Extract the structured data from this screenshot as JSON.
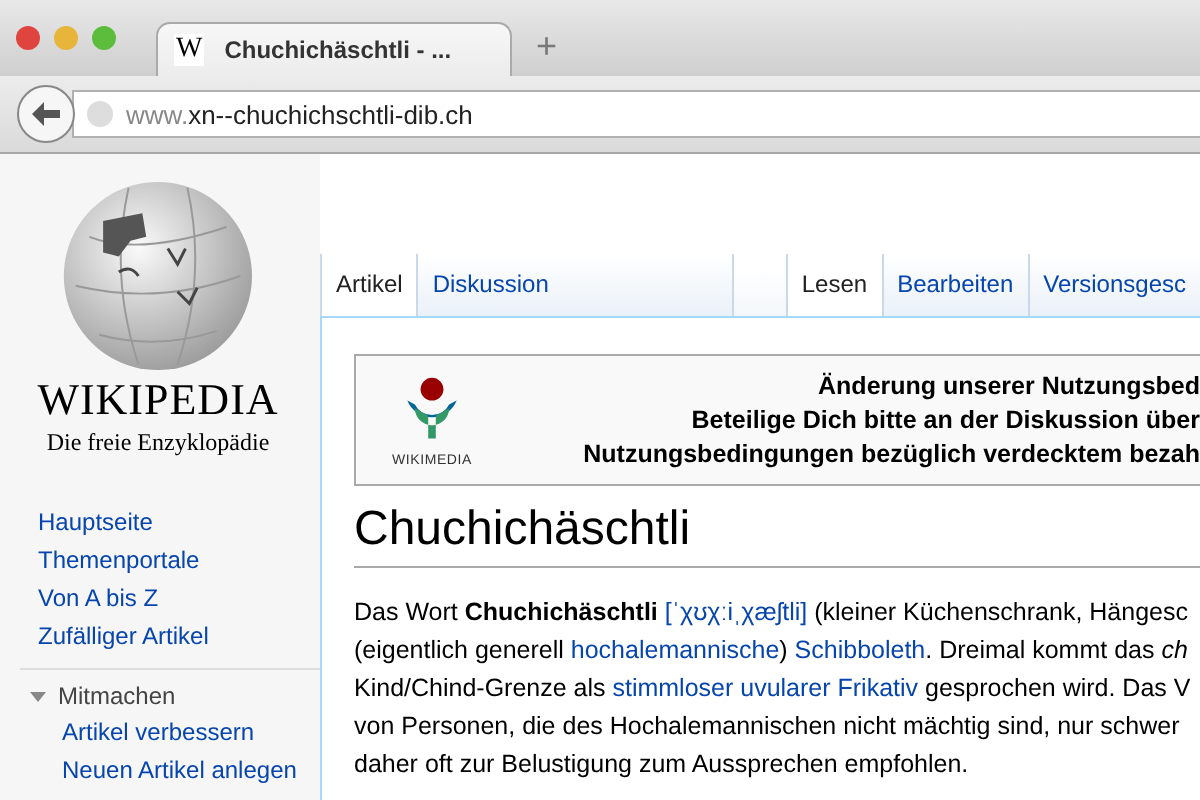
{
  "window": {
    "tab_title": "Chuchichäschtli - ...",
    "tab_icon": "W",
    "new_tab": "+",
    "url_prefix": "www.",
    "url_rest": "xn--chuchichschtli-dib.ch"
  },
  "sidebar": {
    "logo_title": "WIKIPEDIA",
    "logo_subtitle": "Die freie Enzyklopädie",
    "nav": [
      "Hauptseite",
      "Themenportale",
      "Von A bis Z",
      "Zufälliger Artikel"
    ],
    "section": {
      "title": "Mitmachen",
      "expanded": true,
      "items": [
        "Artikel verbessern",
        "Neuen Artikel anlegen"
      ]
    }
  },
  "tabs_left": [
    {
      "label": "Artikel",
      "selected": true
    },
    {
      "label": "Diskussion",
      "selected": false
    }
  ],
  "tabs_right": [
    {
      "label": "Lesen",
      "selected": true
    },
    {
      "label": "Bearbeiten",
      "selected": false
    },
    {
      "label": "Versionsgesc",
      "selected": false
    }
  ],
  "banner": {
    "logo_label": "WIKIMEDIA",
    "lines": [
      "Änderung unserer Nutzungsbed",
      "Beteilige Dich bitte an der Diskussion über",
      "Nutzungsbedingungen bezüglich verdecktem bezah"
    ]
  },
  "article": {
    "title": "Chuchichäschtli",
    "lines": [
      [
        {
          "kind": "text",
          "text": "Das Wort "
        },
        {
          "kind": "bold",
          "text": "Chuchichäschtli "
        },
        {
          "kind": "link",
          "text": "[ˈχʊχːiˌχæʃtli]"
        },
        {
          "kind": "text",
          "text": " (kleiner Küchenschrank, Hängesc"
        }
      ],
      [
        {
          "kind": "text",
          "text": "(eigentlich generell "
        },
        {
          "kind": "link",
          "text": "hochalemannische"
        },
        {
          "kind": "text",
          "text": ") "
        },
        {
          "kind": "link",
          "text": "Schibboleth"
        },
        {
          "kind": "text",
          "text": ". Dreimal kommt das "
        },
        {
          "kind": "italic",
          "text": "ch"
        }
      ],
      [
        {
          "kind": "text",
          "text": "Kind/Chind-Grenze als "
        },
        {
          "kind": "link",
          "text": "stimmloser uvularer Frikativ"
        },
        {
          "kind": "text",
          "text": " gesprochen wird. Das V"
        }
      ],
      [
        {
          "kind": "text",
          "text": "von Personen, die des Hochalemannischen nicht mächtig sind, nur schwer"
        }
      ],
      [
        {
          "kind": "text",
          "text": "daher oft zur Belustigung zum Aussprechen empfohlen."
        }
      ]
    ]
  }
}
